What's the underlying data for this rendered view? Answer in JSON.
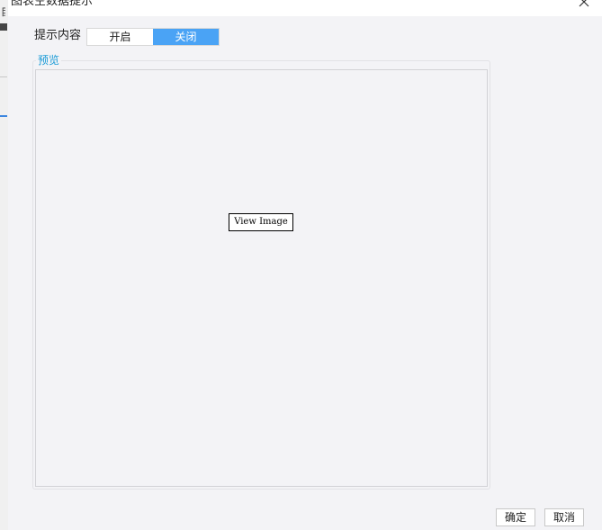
{
  "window": {
    "title": "图表空数据提示",
    "close_icon": "close-icon"
  },
  "background_app": {
    "partial_text": "目"
  },
  "prompt_content": {
    "label": "提示内容",
    "options": [
      {
        "label": "开启",
        "selected": false
      },
      {
        "label": "关闭",
        "selected": true
      }
    ],
    "selected_color": "#4aa3f5"
  },
  "preview": {
    "legend": "预览",
    "legend_color": "#1a9bd7",
    "image_button_label": "View Image"
  },
  "footer": {
    "ok_label": "确定",
    "cancel_label": "取消"
  }
}
